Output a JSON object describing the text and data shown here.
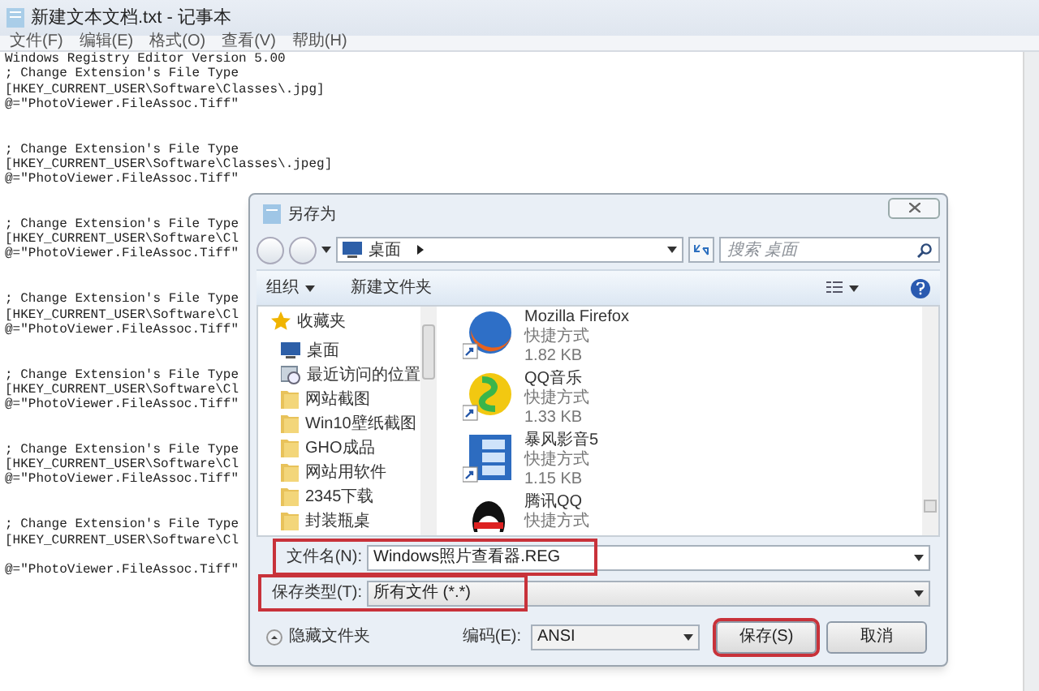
{
  "notepad": {
    "title": "新建文本文档.txt - 记事本",
    "menu": [
      "文件(F)",
      "编辑(E)",
      "格式(O)",
      "查看(V)",
      "帮助(H)"
    ],
    "lines": [
      {
        "kind": "text",
        "text": "Windows Registry Editor Version 5.00"
      },
      {
        "kind": "text",
        "text": "; Change Extension's File Type"
      },
      {
        "kind": "text",
        "text": "[HKEY_CURRENT_USER\\Software\\Classes\\.jpg]"
      },
      {
        "kind": "text",
        "text": "@=\"PhotoViewer.FileAssoc.Tiff\""
      },
      {
        "kind": "blank"
      },
      {
        "kind": "blank"
      },
      {
        "kind": "text",
        "text": "; Change Extension's File Type"
      },
      {
        "kind": "text",
        "text": "[HKEY_CURRENT_USER\\Software\\Classes\\.jpeg]"
      },
      {
        "kind": "text",
        "text": "@=\"PhotoViewer.FileAssoc.Tiff\""
      },
      {
        "kind": "blank"
      },
      {
        "kind": "blank"
      },
      {
        "kind": "text",
        "text": "; Change Extension's File Type"
      },
      {
        "kind": "text",
        "text": "[HKEY_CURRENT_USER\\Software\\Cl"
      },
      {
        "kind": "text",
        "text": "@=\"PhotoViewer.FileAssoc.Tiff\""
      },
      {
        "kind": "blank"
      },
      {
        "kind": "blank"
      },
      {
        "kind": "text",
        "text": "; Change Extension's File Type"
      },
      {
        "kind": "text",
        "text": "[HKEY_CURRENT_USER\\Software\\Cl"
      },
      {
        "kind": "text",
        "text": "@=\"PhotoViewer.FileAssoc.Tiff\""
      },
      {
        "kind": "blank"
      },
      {
        "kind": "blank"
      },
      {
        "kind": "text",
        "text": "; Change Extension's File Type"
      },
      {
        "kind": "text",
        "text": "[HKEY_CURRENT_USER\\Software\\Cl"
      },
      {
        "kind": "text",
        "text": "@=\"PhotoViewer.FileAssoc.Tiff\""
      },
      {
        "kind": "blank"
      },
      {
        "kind": "blank"
      },
      {
        "kind": "text",
        "text": "; Change Extension's File Type"
      },
      {
        "kind": "text",
        "text": "[HKEY_CURRENT_USER\\Software\\Cl"
      },
      {
        "kind": "text",
        "text": "@=\"PhotoViewer.FileAssoc.Tiff\""
      },
      {
        "kind": "blank"
      },
      {
        "kind": "blank"
      },
      {
        "kind": "text",
        "text": "; Change Extension's File Type"
      },
      {
        "kind": "text",
        "text": "[HKEY_CURRENT_USER\\Software\\Cl"
      },
      {
        "kind": "blank"
      },
      {
        "kind": "text",
        "text": "@=\"PhotoViewer.FileAssoc.Tiff\""
      }
    ]
  },
  "dialog": {
    "title": "另存为",
    "address": "桌面",
    "search": {
      "placeholder": "搜索 桌面"
    },
    "toolbar": {
      "organize": "组织",
      "new_folder": "新建文件夹"
    },
    "nav": [
      {
        "label": "收藏夹",
        "kind": "favorites"
      },
      {
        "label": "桌面",
        "kind": "desktop"
      },
      {
        "label": "最近访问的位置",
        "kind": "recent"
      },
      {
        "label": "网站截图",
        "kind": "folder"
      },
      {
        "label": "Win10壁纸截图",
        "kind": "folder"
      },
      {
        "label": "GHO成品",
        "kind": "folder"
      },
      {
        "label": "网站用软件",
        "kind": "folder"
      },
      {
        "label": "2345下载",
        "kind": "folder"
      },
      {
        "label": "封装瓶桌",
        "kind": "folder"
      }
    ],
    "files": [
      {
        "name": "Mozilla Firefox",
        "type": "快捷方式",
        "size": "1.82 KB",
        "kind": "firefox"
      },
      {
        "name": "QQ音乐",
        "type": "快捷方式",
        "size": "1.33 KB",
        "kind": "music"
      },
      {
        "name": "暴风影音5",
        "type": "快捷方式",
        "size": "1.15 KB",
        "kind": "film"
      },
      {
        "name": "腾讯QQ",
        "type": "快捷方式",
        "kind": "penguin"
      }
    ],
    "filename": {
      "label": "文件名(N):",
      "value": "Windows照片查看器.REG",
      "highlighted": true
    },
    "filetype": {
      "label": "保存类型(T):",
      "value": "所有文件 (*.*)",
      "highlighted": true
    },
    "hide_folders": "隐藏文件夹",
    "encoding": {
      "label": "编码(E):",
      "value": "ANSI"
    },
    "buttons": [
      {
        "label": "保存(S)",
        "highlighted": true
      },
      {
        "label": "取消",
        "highlighted": false
      }
    ]
  }
}
